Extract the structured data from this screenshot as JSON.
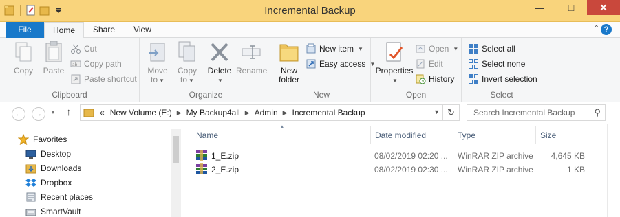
{
  "window": {
    "title": "Incremental Backup"
  },
  "tabs": {
    "file": "File",
    "home": "Home",
    "share": "Share",
    "view": "View"
  },
  "ribbon": {
    "clipboard": {
      "label": "Clipboard",
      "copy": "Copy",
      "paste": "Paste",
      "cut": "Cut",
      "copy_path": "Copy path",
      "paste_shortcut": "Paste shortcut"
    },
    "organize": {
      "label": "Organize",
      "move_to_1": "Move",
      "move_to_2": "to",
      "copy_to_1": "Copy",
      "copy_to_2": "to",
      "delete": "Delete",
      "rename": "Rename"
    },
    "new": {
      "label": "New",
      "new_folder_1": "New",
      "new_folder_2": "folder",
      "new_item": "New item",
      "easy_access": "Easy access"
    },
    "open": {
      "label": "Open",
      "properties": "Properties",
      "open": "Open",
      "edit": "Edit",
      "history": "History"
    },
    "select": {
      "label": "Select",
      "select_all": "Select all",
      "select_none": "Select none",
      "invert_selection": "Invert selection"
    }
  },
  "address": {
    "overflow": "«",
    "crumbs": [
      "New Volume (E:)",
      "My Backup4all",
      "Admin",
      "Incremental Backup"
    ],
    "search_placeholder": "Search Incremental Backup"
  },
  "nav_pane": {
    "items": [
      {
        "label": "Favorites",
        "icon": "star-icon"
      },
      {
        "label": "Desktop",
        "icon": "desktop-icon"
      },
      {
        "label": "Downloads",
        "icon": "downloads-folder-icon"
      },
      {
        "label": "Dropbox",
        "icon": "dropbox-icon"
      },
      {
        "label": "Recent places",
        "icon": "recent-places-icon"
      },
      {
        "label": "SmartVault",
        "icon": "smartvault-icon"
      }
    ]
  },
  "file_list": {
    "columns": {
      "name": "Name",
      "date": "Date modified",
      "type": "Type",
      "size": "Size"
    },
    "rows": [
      {
        "name": "1_E.zip",
        "date": "08/02/2019 02:20 ...",
        "type": "WinRAR ZIP archive",
        "size": "4,645 KB",
        "icon": "winrar-archive-icon"
      },
      {
        "name": "2_E.zip",
        "date": "08/02/2019 02:30 ...",
        "type": "WinRAR ZIP archive",
        "size": "1 KB",
        "icon": "winrar-archive-icon"
      }
    ]
  },
  "colors": {
    "title_bar": "#f9d47c",
    "file_tab": "#1979ca",
    "close_button": "#c9483c",
    "header_text": "#4c607a"
  }
}
